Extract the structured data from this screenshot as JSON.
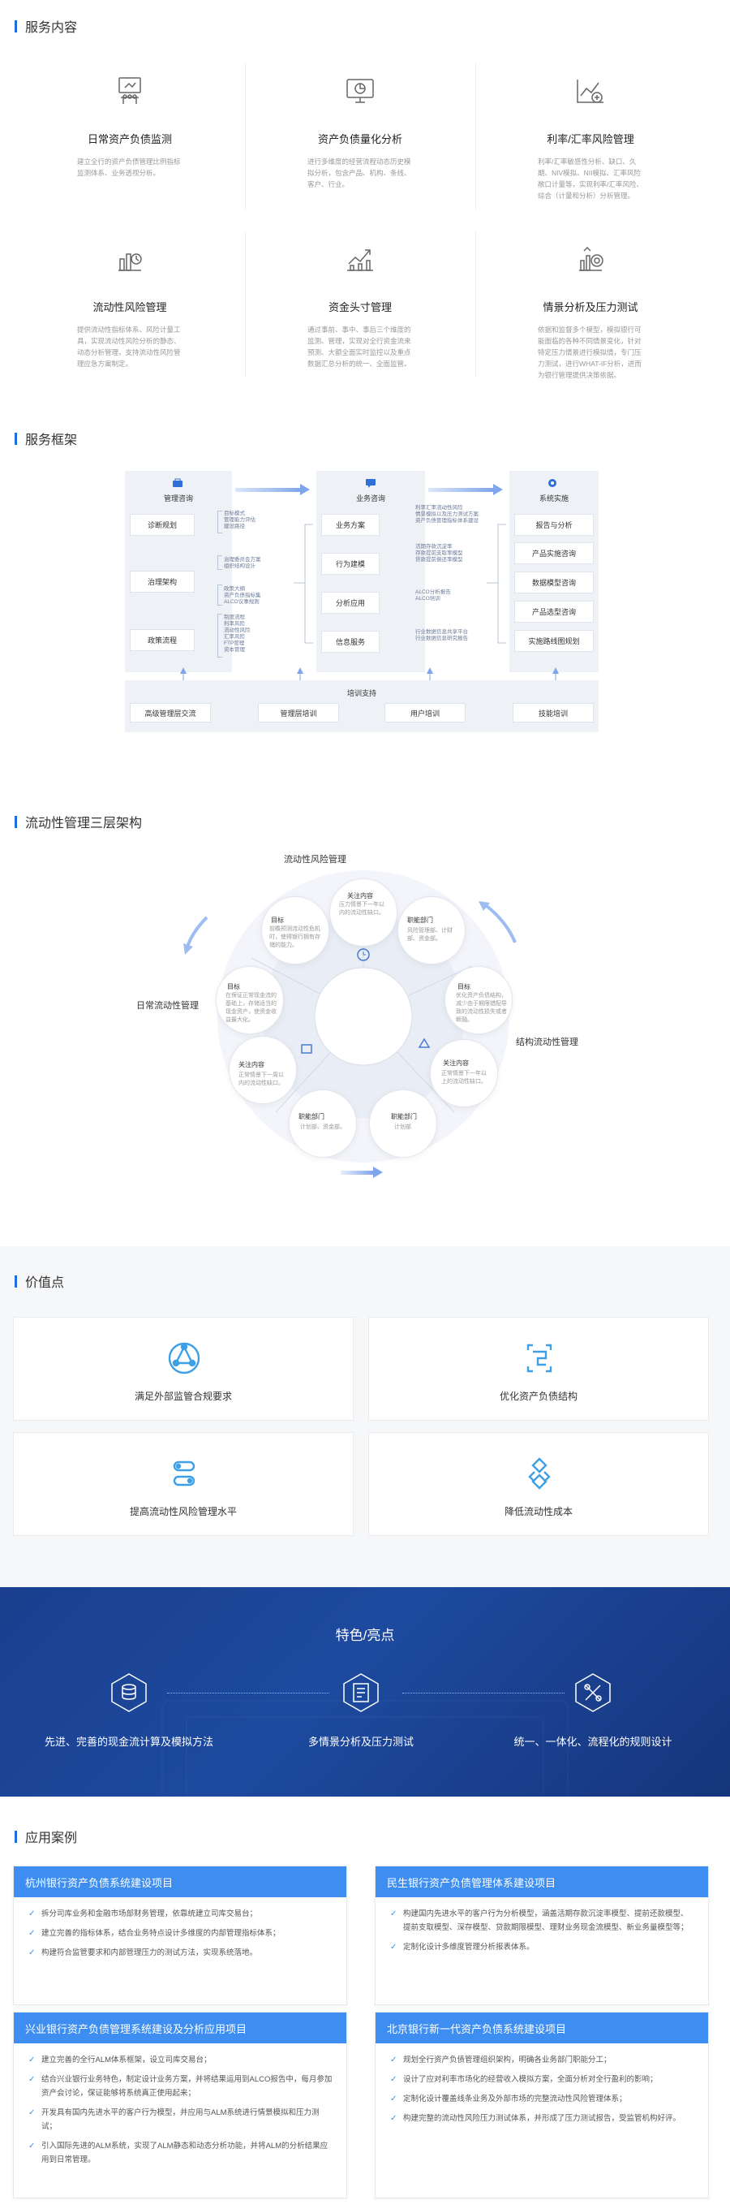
{
  "sections": {
    "services": "服务内容",
    "framework": "服务框架",
    "three_layer": "流动性管理三层架构",
    "value": "价值点",
    "cases": "应用案例"
  },
  "services": [
    {
      "name": "日常资产负债监测",
      "desc": "建立全行的资产负债管理比例指标监测体系、业务透视分析。",
      "icon": "meeting-icon"
    },
    {
      "name": "资产负债量化分析",
      "desc": "进行多维度的经营流程动态历史模拟分析，包含产品、机构、条线、客户、行业。",
      "icon": "monitor-chart-icon"
    },
    {
      "name": "利率/汇率风险管理",
      "desc": "利率/汇率敏感性分析、缺口、久期、NIV模拟、NII模拟、汇率风险敞口计量等，实现利率/汇率风险、综合（计量和分析）分析管理。",
      "icon": "rate-analysis-icon"
    },
    {
      "name": "流动性风险管理",
      "desc": "提供流动性指标体系、风险计量工具，实现流动性风险分析的静态、动态分析管理，支持流动性风险管理应急方案制定。",
      "icon": "liquidity-chart-icon"
    },
    {
      "name": "资金头寸管理",
      "desc": "通过事前、事中、事后三个维度的监测、管理，实现对全行资金流来预测、大额全面实时监控以及重点数据汇总分析的统一、全面监管。",
      "icon": "cash-position-icon"
    },
    {
      "name": "情景分析及压力测试",
      "desc": "依据和监督多个模型，模拟银行可能面临的各种不同情景变化，针对特定压力情景进行模拟情，专门压力测试，进行WHAT-IF分析，进而为银行管理提供决策依据。",
      "icon": "scenario-test-icon"
    }
  ],
  "framework": {
    "col1": {
      "title": "管理咨询",
      "items": [
        "诊断规划",
        "治理架构",
        "政策流程"
      ]
    },
    "col2": {
      "title": "业务咨询",
      "items": [
        "业务方案",
        "行为建模",
        "分析应用",
        "信息服务"
      ]
    },
    "col3": {
      "title": "系统实施",
      "items": [
        "报告与分析",
        "产品实施咨询",
        "数据模型咨询",
        "产品选型咨询",
        "实施路线图规划"
      ]
    },
    "notes1": [
      "目标模式",
      "管理能力评估",
      "建设路径"
    ],
    "notes2": [
      "治理委员会方案",
      "组织结构设计"
    ],
    "notes3": [
      "政策大纲",
      "资产负债指标集",
      "ALCO议事规则"
    ],
    "notes4": [
      "制度流程",
      "利率风险",
      "流动性风险",
      "汇率风险",
      "FTP管理",
      "资本管理"
    ],
    "notes5": [
      "利率汇率流动性风险",
      "情景模拟以及压力测试方案",
      "资产负债管理指标体系建设"
    ],
    "notes6": [
      "活期存款沉淀率",
      "存款提前支取率模型",
      "贷款提前偿还率模型"
    ],
    "notes7": [
      "ALCO分析报告",
      "ALCO培训"
    ],
    "notes8": [
      "行业数据信息共享平台",
      "行业数据信息研究报告"
    ],
    "support_title": "培训支持",
    "support_items": [
      "高级管理层交流",
      "管理层培训",
      "用户培训",
      "技能培训"
    ]
  },
  "three_layer": {
    "label_top": "流动性风险管理",
    "label_left": "日常流动性管理",
    "label_right": "结构流动性管理",
    "nodes": [
      {
        "t": "关注内容",
        "d": "压力情景下一年以内的流动性缺口。"
      },
      {
        "t": "职能部门",
        "d": "风险管理部、计财部、资金部。"
      },
      {
        "t": "目标",
        "d": "优化资产负债结构，减少由于期限错配导致的流动性损失或者断融。"
      },
      {
        "t": "关注内容",
        "d": "正常情景下一年以上的流动性缺口。"
      },
      {
        "t": "职能部门",
        "d": "计划部"
      },
      {
        "t": "职能部门",
        "d": "计划部、资金部。"
      },
      {
        "t": "关注内容",
        "d": "正常情景下一周以内的流动性缺口。"
      },
      {
        "t": "目标",
        "d": "在保证正常现金流的基础上，存储适当的现金资产，使资金收益最大化。"
      },
      {
        "t": "目标",
        "d": "前瞻预测流动性危机时，使得银行拥有存储的能力。"
      }
    ]
  },
  "value": [
    {
      "label": "满足外部监管合规要求",
      "icon": "compliance-icon"
    },
    {
      "label": "优化资产负债结构",
      "icon": "structure-icon"
    },
    {
      "label": "提高流动性风险管理水平",
      "icon": "level-icon"
    },
    {
      "label": "降低流动性成本",
      "icon": "cost-icon"
    }
  ],
  "features": {
    "title": "特色/亮点",
    "items": [
      {
        "label": "先进、完善的现金流计算及模拟方法",
        "icon": "cash-flow-icon"
      },
      {
        "label": "多情景分析及压力测试",
        "icon": "scenario-icon"
      },
      {
        "label": "统一、一体化、流程化的规则设计",
        "icon": "tools-icon"
      }
    ]
  },
  "cases": [
    {
      "title": "杭州银行资产负债系统建设项目",
      "items": [
        "拆分司库业务和金融市场部财务管理，依靠统建立司库交易台；",
        "建立完善的指标体系，结合业务特点设计多维度的内部管理指标体系；",
        "构建符合监管要求和内部管理压力的测试方法，实现系统落地。"
      ]
    },
    {
      "title": "民生银行资产负债管理体系建设项目",
      "items": [
        "构建国内先进水平的客户行为分析模型，涵盖活期存款沉淀率模型、提前还款模型、提前支取模型、深存模型、贷款期限模型、理财业务现金流模型、新业务量模型等；",
        "定制化设计多维度管理分析报表体系。"
      ]
    },
    {
      "title": "兴业银行资产负债管理系统建设及分析应用项目",
      "items": [
        "建立完善的全行ALM体系框架，设立司库交易台；",
        "结合兴业银行业务特色，制定设计业务方案，并将结果运用到ALCO报告中，每月参加资产会讨论，保证能够将系统真正使用起来；",
        "开发具有国内先进水平的客户行为模型，并应用与ALM系统进行情景模拟和压力测试；",
        "引入国际先进的ALM系统，实现了ALM静态和动态分析功能，并将ALM的分析结果应用到日常管理。"
      ]
    },
    {
      "title": "北京银行新一代资产负债系统建设项目",
      "items": [
        "规划全行资产负债管理组织架构，明确各业务部门职能分工；",
        "设计了应对利率市场化的经营收入模拟方案，全面分析对全行盈利的影响；",
        "定制化设计覆盖线条业务及外部市场的完整流动性风险管理体系；",
        "构建完整的流动性风险压力测试体系，并形成了压力测试报告，受监管机构好评。"
      ]
    }
  ]
}
